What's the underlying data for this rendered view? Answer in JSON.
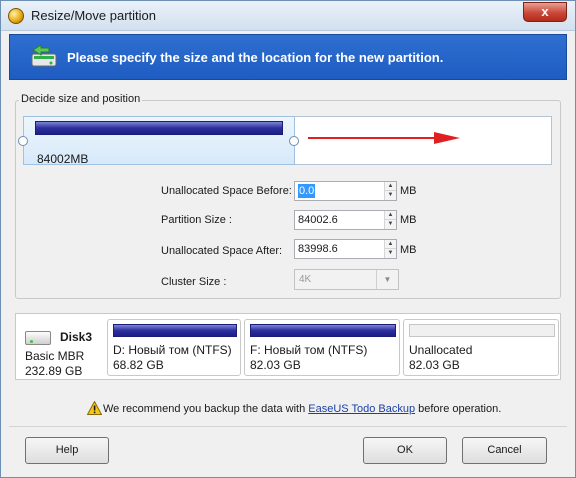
{
  "window": {
    "title": "Resize/Move partition",
    "close_glyph": "x"
  },
  "banner": {
    "text": "Please specify the size and the location for the new partition."
  },
  "group": {
    "label": "Decide size and position",
    "partition_size_display": "84002MB"
  },
  "form": {
    "unallocated_before": {
      "label": "Unallocated Space Before:",
      "value": "0.0",
      "unit": "MB"
    },
    "partition_size": {
      "label": "Partition Size :",
      "value": "84002.6",
      "unit": "MB"
    },
    "unallocated_after": {
      "label": "Unallocated Space After:",
      "value": "83998.6",
      "unit": "MB"
    },
    "cluster_size": {
      "label": "Cluster Size :",
      "value": "4K"
    }
  },
  "disk": {
    "name": "Disk3",
    "type": "Basic MBR",
    "capacity": "232.89 GB",
    "partitions": [
      {
        "name": "D: Новый том (NTFS)",
        "size": "68.82 GB",
        "used_fraction": 1.0,
        "kind": "partition"
      },
      {
        "name": "F: Новый том (NTFS)",
        "size": "82.03 GB",
        "used_fraction": 1.0,
        "kind": "partition"
      },
      {
        "name": "Unallocated",
        "size": "82.03 GB",
        "used_fraction": 0.0,
        "kind": "unallocated"
      }
    ]
  },
  "recommend": {
    "prefix": "We recommend you backup the data with ",
    "link": "EaseUS Todo Backup",
    "suffix": " before operation."
  },
  "buttons": {
    "help": "Help",
    "ok": "OK",
    "cancel": "Cancel"
  },
  "colors": {
    "banner": "#2567cc",
    "partition_bar": "#2c2f9d",
    "arrow": "#e02020"
  },
  "icons": {
    "app": "app-disk-icon",
    "banner": "resize-partition-icon",
    "disk": "hard-disk-icon",
    "warning": "warning-icon",
    "arrow": "move-right-arrow-icon"
  }
}
